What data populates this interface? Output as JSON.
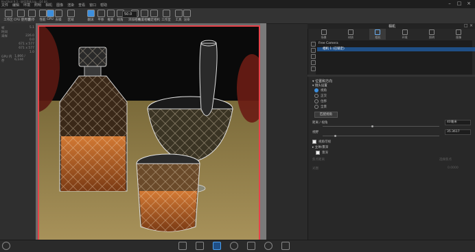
{
  "app": {
    "title": "KeyShot 9.3 - 玻璃酒具.bip - 64 bit",
    "menu": [
      "文件",
      "编辑",
      "环境",
      "照明",
      "相机",
      "图像",
      "渲染",
      "查看",
      "窗口",
      "帮助"
    ]
  },
  "toolbar": {
    "tools": [
      {
        "label": "工作区",
        "active": false
      },
      {
        "label": "CPU 使用量",
        "active": false
      },
      {
        "label": "暂停",
        "active": false
      },
      {
        "label": "性能",
        "active": false
      },
      {
        "label": "GPU",
        "active": true
      },
      {
        "label": "去噪",
        "active": false
      },
      {
        "label": "区域",
        "active": false
      },
      {
        "label": "翻滚",
        "active": true
      },
      {
        "label": "平移",
        "active": false
      },
      {
        "label": "推移",
        "active": false
      },
      {
        "label": "视角",
        "active": false
      },
      {
        "label": "添加相机",
        "active": false
      },
      {
        "label": "重置相机",
        "active": false
      },
      {
        "label": "锁定相机",
        "active": false
      },
      {
        "label": "工作室",
        "active": false
      },
      {
        "label": "工具",
        "active": false
      },
      {
        "label": "渲染",
        "active": false
      }
    ],
    "zoom_value": "50.0"
  },
  "stats": [
    {
      "k": "帧",
      "v": "5.1"
    },
    {
      "k": "时间",
      "v": ""
    },
    {
      "k": "采样",
      "v": "226.0"
    },
    {
      "k": "",
      "v": "0.0"
    },
    {
      "k": "",
      "v": "671 x 577"
    },
    {
      "k": "",
      "v": "671 x 577"
    },
    {
      "k": "",
      "v": "1.0"
    },
    {
      "k": "GPU 内存",
      "v": "1,866 / 6,144"
    }
  ],
  "panel": {
    "title": "相机",
    "tabs": [
      {
        "label": "场景",
        "active": false
      },
      {
        "label": "材质",
        "active": false
      },
      {
        "label": "相机",
        "active": true
      },
      {
        "label": "环境",
        "active": false
      },
      {
        "label": "照明",
        "active": false
      },
      {
        "label": "图像",
        "active": false
      }
    ],
    "camera_list": [
      {
        "label": "Free Camera",
        "selected": false
      },
      {
        "label": "相机 1 (已锁定)",
        "selected": true
      }
    ],
    "section_position": "位置和方向",
    "subsection_mode": "镜头设置",
    "modes": [
      {
        "label": "视角",
        "on": true
      },
      {
        "label": "正交",
        "on": false
      },
      {
        "label": "位移",
        "on": false
      },
      {
        "label": "全景",
        "on": false
      }
    ],
    "match_button": "匹配视角",
    "distance_label": "距离 / 视角",
    "distance_value": "40毫米",
    "fov_label": "视野",
    "fov_value": "35.3617",
    "perspective_check": "视角可视",
    "section_stereo": "立体/景深",
    "depth_check": "景深",
    "focus_label": "焦点距离",
    "aperture_label": "光圈",
    "focus_hint": "选择焦点",
    "aperture_hint": "0.0000"
  },
  "colors": {
    "accent": "#3d8fdd",
    "selection": "#1f4f86",
    "render_border": "#e8424a"
  }
}
